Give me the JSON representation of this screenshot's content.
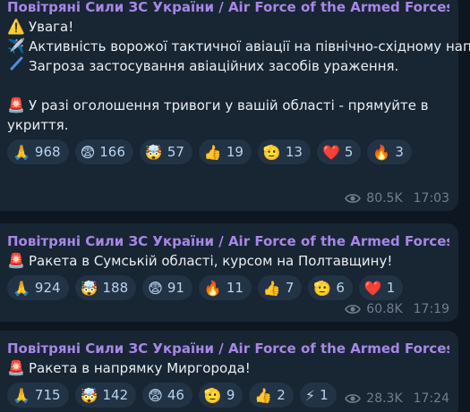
{
  "messages": [
    {
      "sender": "Повітряні Сили ЗС України / Air Force of the Armed Forces of U...",
      "lines": [
        {
          "icon": "⚠️",
          "icon_name": "warning-icon",
          "text": "Увага!"
        },
        {
          "icon": "✈️",
          "icon_name": "airplane-icon",
          "text": "Активність ворожої тактичної авіації на північно-східному напрямку!"
        },
        {
          "icon": "",
          "icon_name": "missile-icon",
          "text": "Загроза застосування авіаційних засобів ураження."
        },
        {
          "icon": "",
          "icon_name": "",
          "text": ""
        },
        {
          "icon": "🚨",
          "icon_name": "siren-icon",
          "text": "У разі оголошення тривоги у вашій області - прямуйте в укриття."
        }
      ],
      "reactions": [
        {
          "emoji": "🙏",
          "name": "pray",
          "count": "968"
        },
        {
          "emoji": "😨",
          "name": "fearful",
          "count": "166"
        },
        {
          "emoji": "🤯",
          "name": "exploding-head",
          "count": "57"
        },
        {
          "emoji": "👍",
          "name": "thumbs-up",
          "count": "19"
        },
        {
          "emoji": "🫡",
          "name": "salute",
          "count": "13"
        },
        {
          "emoji": "❤️",
          "name": "heart",
          "count": "5"
        },
        {
          "emoji": "🔥",
          "name": "fire",
          "count": "3"
        }
      ],
      "views": "80.5K",
      "time": "17:03"
    },
    {
      "sender": "Повітряні Сили ЗС України / Air Force of the Armed Forces of U...",
      "lines": [
        {
          "icon": "🚨",
          "icon_name": "siren-icon",
          "text": "Ракета в Сумській області, курсом на Полтавщину!"
        }
      ],
      "reactions": [
        {
          "emoji": "🙏",
          "name": "pray",
          "count": "924"
        },
        {
          "emoji": "🤯",
          "name": "exploding-head",
          "count": "188"
        },
        {
          "emoji": "😨",
          "name": "fearful",
          "count": "91"
        },
        {
          "emoji": "🔥",
          "name": "fire",
          "count": "11"
        },
        {
          "emoji": "👍",
          "name": "thumbs-up",
          "count": "7"
        },
        {
          "emoji": "🫡",
          "name": "salute",
          "count": "6"
        },
        {
          "emoji": "❤️",
          "name": "heart",
          "count": "1"
        }
      ],
      "views": "60.8K",
      "time": "17:19"
    },
    {
      "sender": "Повітряні Сили ЗС України / Air Force of the Armed Forces of U...",
      "lines": [
        {
          "icon": "🚨",
          "icon_name": "siren-icon",
          "text": "Ракета в напрямку Миргорода!"
        }
      ],
      "reactions": [
        {
          "emoji": "🙏",
          "name": "pray",
          "count": "715"
        },
        {
          "emoji": "🤯",
          "name": "exploding-head",
          "count": "142"
        },
        {
          "emoji": "😨",
          "name": "fearful",
          "count": "46"
        },
        {
          "emoji": "🫡",
          "name": "salute",
          "count": "9"
        },
        {
          "emoji": "👍",
          "name": "thumbs-up",
          "count": "2"
        },
        {
          "emoji": "⚡",
          "name": "lightning",
          "count": "1"
        }
      ],
      "views": "28.3K",
      "time": "17:24"
    }
  ]
}
